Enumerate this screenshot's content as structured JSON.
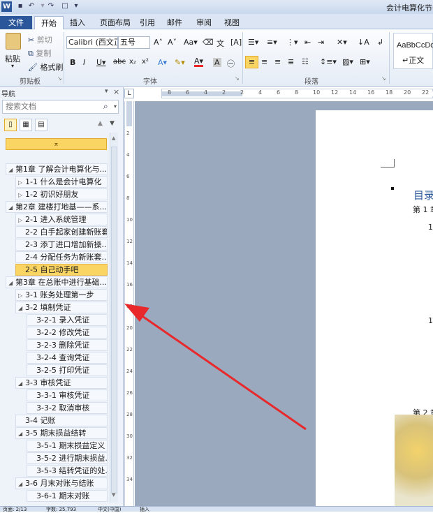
{
  "window": {
    "title": "会计电算化节省"
  },
  "quick_access": {
    "icons": [
      "word-logo-icon",
      "save-icon",
      "undo-icon",
      "redo-icon",
      "new-doc-icon",
      "customize-icon"
    ]
  },
  "tabs": [
    "文件",
    "开始",
    "插入",
    "页面布局",
    "引用",
    "邮件",
    "审阅",
    "视图"
  ],
  "clipboard": {
    "paste": "粘贴",
    "cut": "剪切",
    "copy": "复制",
    "format_painter": "格式刷",
    "group_label": "剪贴板"
  },
  "font": {
    "name": "Calibri (西文正",
    "size": "五号",
    "group_label": "字体"
  },
  "paragraph": {
    "group_label": "段落"
  },
  "styles": {
    "sample": "AaBbCcDd",
    "name": "正文"
  },
  "nav": {
    "title": "导航",
    "close": "×",
    "search_placeholder": "搜索文档",
    "items": [
      {
        "text": "第1章 了解会计电算化与...",
        "arrow": "◢"
      },
      {
        "text": "1-1 什么是会计电算化",
        "arrow": "▷"
      },
      {
        "text": "1-2 初识好朋友",
        "arrow": "▷"
      },
      {
        "text": "第2章 建楼打地基——系...",
        "arrow": "◢"
      },
      {
        "text": "2-1 进入系统管理",
        "arrow": "▷"
      },
      {
        "text": "2-2 白手起家创建新账套",
        "arrow": ""
      },
      {
        "text": "2-3 添丁进口增加新操...",
        "arrow": ""
      },
      {
        "text": "2-4 分配任务为新账套...",
        "arrow": ""
      },
      {
        "text": "2-5 自己动手吧",
        "arrow": ""
      },
      {
        "text": "第3章 在总账中进行基础...",
        "arrow": "◢"
      },
      {
        "text": "3-1 账务处理第一步",
        "arrow": "▷"
      },
      {
        "text": "3-2 填制凭证",
        "arrow": "◢"
      },
      {
        "text": "3-2-1 录入凭证",
        "arrow": ""
      },
      {
        "text": "3-2-2 修改凭证",
        "arrow": ""
      },
      {
        "text": "3-2-3 删除凭证",
        "arrow": ""
      },
      {
        "text": "3-2-4 查询凭证",
        "arrow": ""
      },
      {
        "text": "3-2-5 打印凭证",
        "arrow": ""
      },
      {
        "text": "3-3 审核凭证",
        "arrow": "◢"
      },
      {
        "text": "3-3-1 审核凭证",
        "arrow": ""
      },
      {
        "text": "3-3-2 取消审核",
        "arrow": ""
      },
      {
        "text": "3-4 记账",
        "arrow": ""
      },
      {
        "text": "3-5 期末损益结转",
        "arrow": "◢"
      },
      {
        "text": "3-5-1 期末损益定义",
        "arrow": ""
      },
      {
        "text": "3-5-2 进行期末损益...",
        "arrow": ""
      },
      {
        "text": "3-5-3 结转凭证的处...",
        "arrow": ""
      },
      {
        "text": "3-6 月末对账与结账",
        "arrow": "◢"
      },
      {
        "text": "3-6-1 期末对账",
        "arrow": ""
      }
    ]
  },
  "hruler_labels": [
    "8",
    "6",
    "4",
    "2",
    "2",
    "4",
    "6",
    "8",
    "10",
    "12",
    "14",
    "16",
    "18",
    "20",
    "22"
  ],
  "vruler_labels": [
    "2",
    "4",
    "6",
    "8",
    "10",
    "12",
    "14",
    "16",
    "18",
    "20",
    "22",
    "24",
    "26",
    "28",
    "30",
    "32",
    "34"
  ],
  "document": {
    "toc_title": "目录",
    "ch1": "第 1 章",
    "ch2": "第 2 章",
    "n1": "1",
    "n2": "1",
    "n3": "2"
  },
  "status": {
    "page": "页面: 2/13",
    "words": "字数: 25,793",
    "lang": "中文(中国)",
    "mode": "插入"
  },
  "colors": {
    "ribbon": "#dbe5f3",
    "file_tab": "#2b579a",
    "highlight": "#fbd564",
    "arrow": "#e8282a"
  }
}
